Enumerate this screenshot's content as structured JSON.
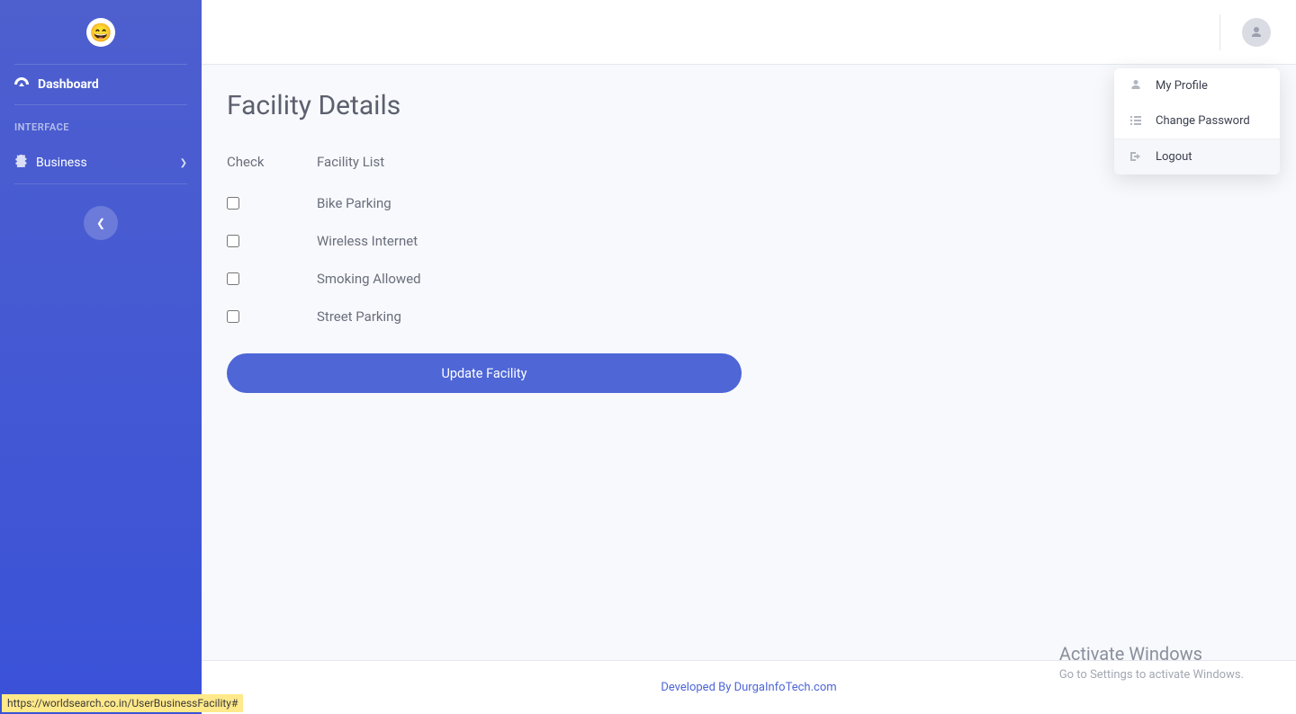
{
  "sidebar": {
    "dashboard": "Dashboard",
    "section": "INTERFACE",
    "business": "Business"
  },
  "dropdown": {
    "profile": "My Profile",
    "change_password": "Change Password",
    "logout": "Logout"
  },
  "page": {
    "title": "Facility Details",
    "col_check": "Check",
    "col_list": "Facility List",
    "items": [
      "Bike Parking",
      "Wireless Internet",
      "Smoking Allowed",
      "Street Parking"
    ],
    "button": "Update Facility"
  },
  "footer": "Developed By DurgaInfoTech.com",
  "watermark": {
    "line1": "Activate Windows",
    "line2": "Go to Settings to activate Windows."
  },
  "status_url": "https://worldsearch.co.in/UserBusinessFacility#"
}
